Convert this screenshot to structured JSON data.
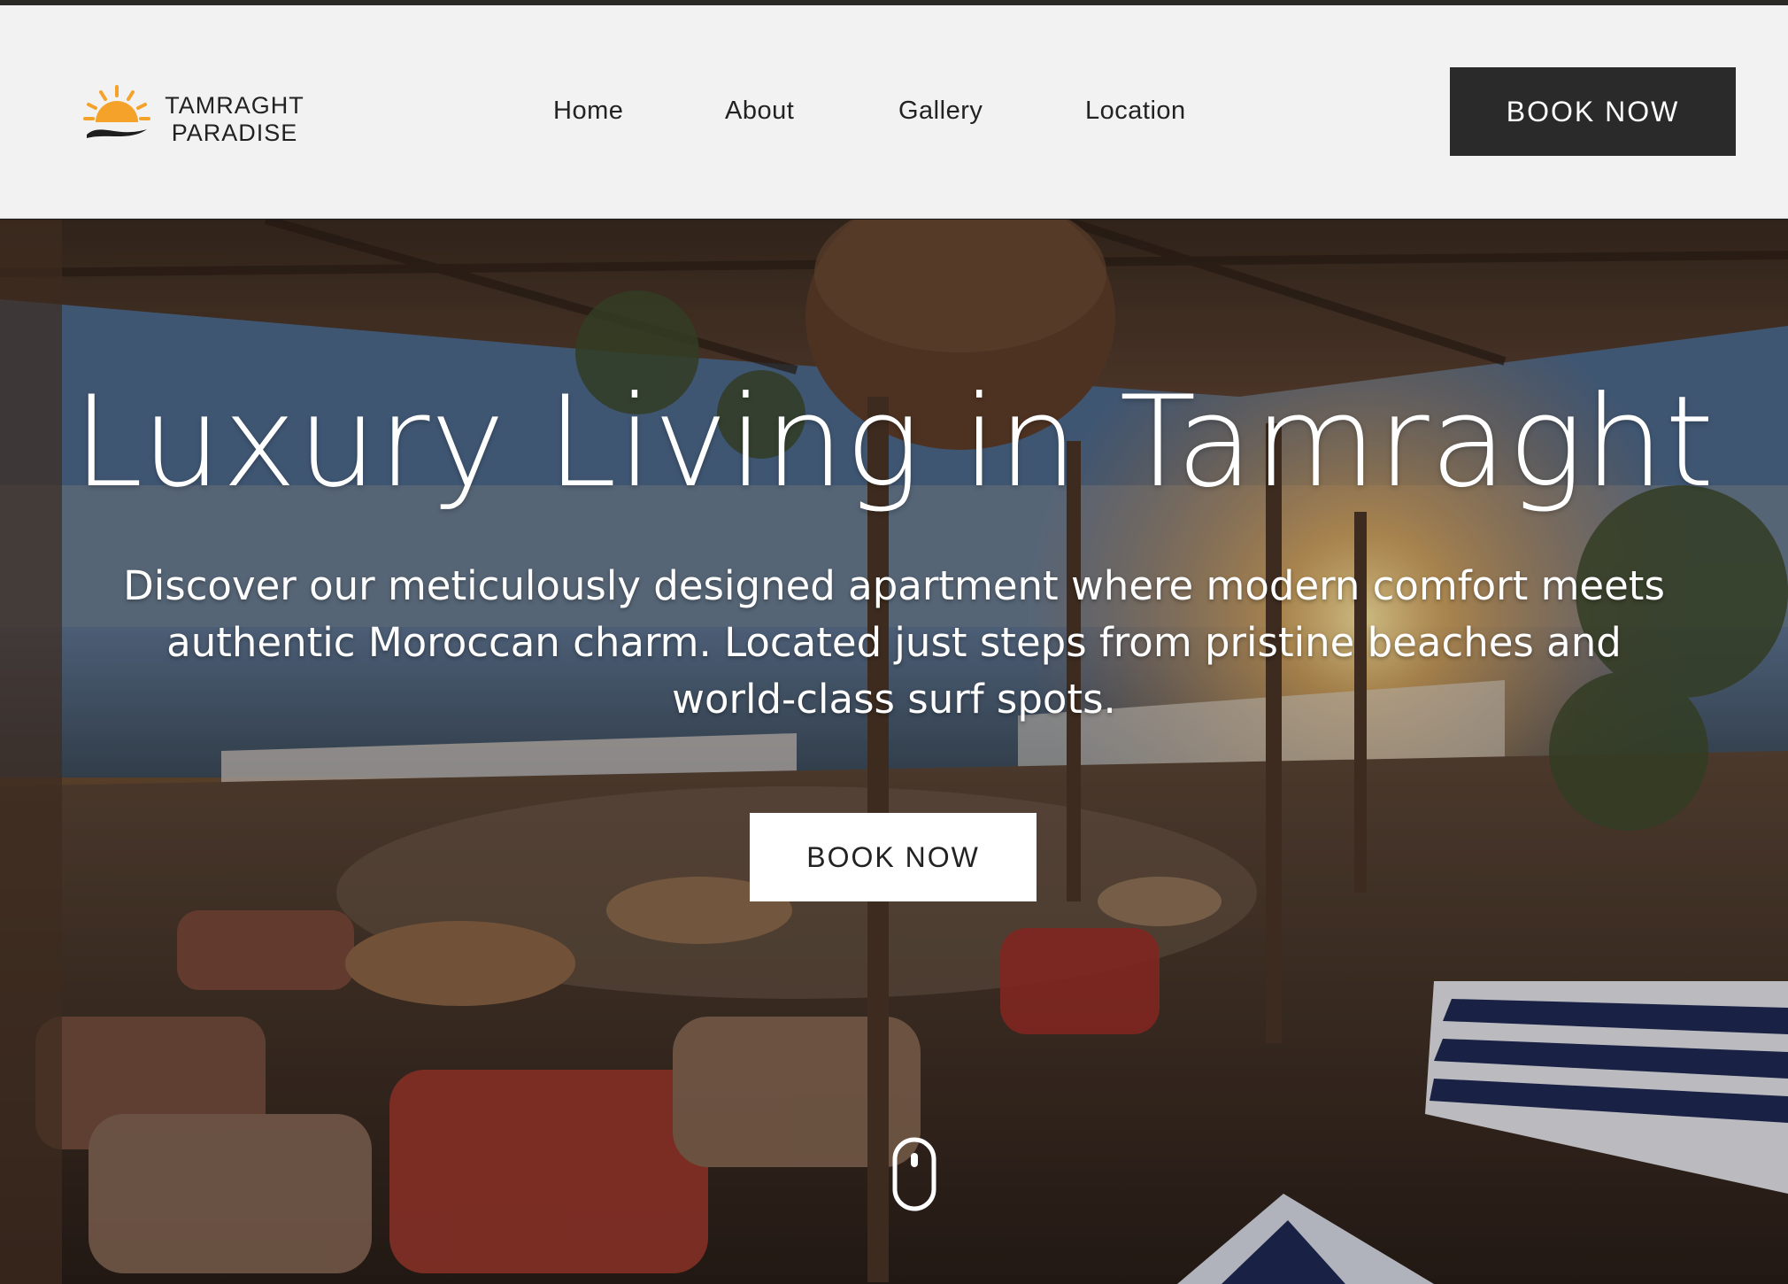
{
  "brand": {
    "line1": "TAMRAGHT",
    "line2": "PARADISE",
    "logo_icon": "sun-over-wave-icon",
    "sun_color": "#f4a22a",
    "wave_color": "#1e1e1e"
  },
  "nav": {
    "items": [
      {
        "label": "Home"
      },
      {
        "label": "About"
      },
      {
        "label": "Gallery"
      },
      {
        "label": "Location"
      }
    ],
    "cta_label": "BOOK NOW"
  },
  "hero": {
    "title": "Luxury Living in Tamraght",
    "subtitle_line1": "Discover our meticulously designed apartment where modern comfort meets",
    "subtitle_line2": "authentic Moroccan charm. Located just steps from pristine beaches and",
    "subtitle_line3": "world-class surf spots.",
    "cta_label": "BOOK NOW",
    "scroll_icon": "mouse-scroll-icon"
  },
  "colors": {
    "header_bg": "#f2f2f2",
    "header_button_bg": "#2a2a2a",
    "hero_button_bg": "#ffffff",
    "text_dark": "#222222"
  }
}
